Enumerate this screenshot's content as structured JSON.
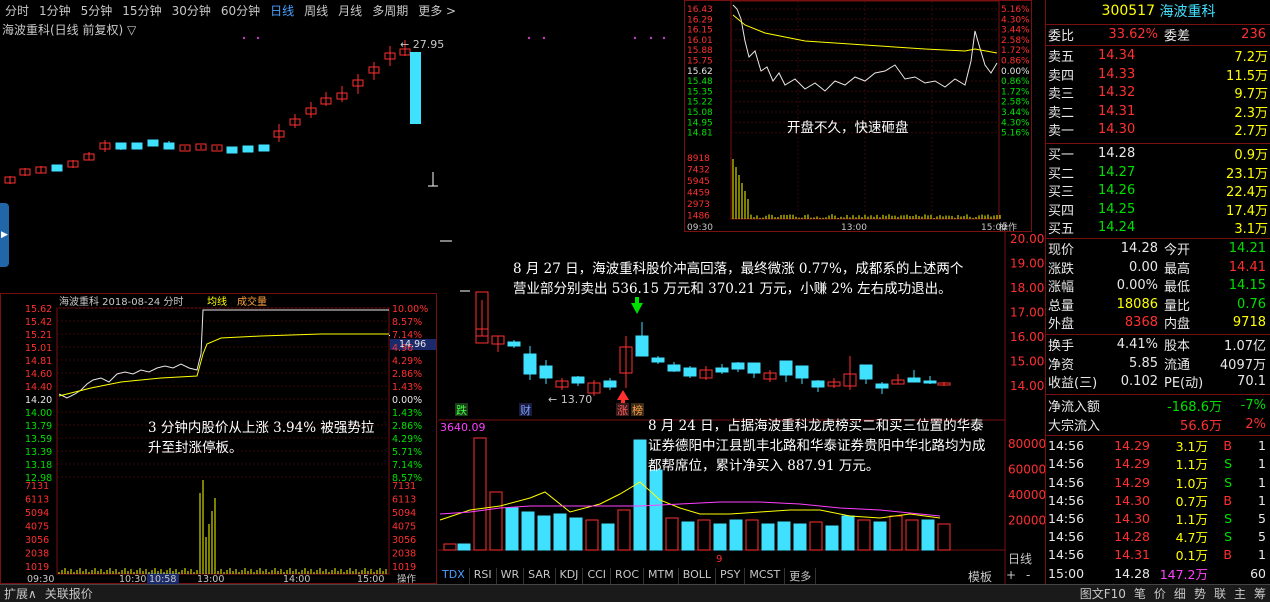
{
  "tabs": [
    "分时",
    "1分钟",
    "5分钟",
    "15分钟",
    "30分钟",
    "60分钟",
    "日线",
    "周线",
    "月线",
    "多周期",
    "更多 >"
  ],
  "active_tab": "日线",
  "kline_title": "海波重科(日线 前复权) ▽",
  "high_label": "← 27.95",
  "low_label": "← 13.70",
  "daily_axis": [
    "20.00",
    "19.00",
    "18.00",
    "17.00",
    "16.00",
    "15.00",
    "14.00"
  ],
  "vol_axis": [
    "80000",
    "60000",
    "40000",
    "20000"
  ],
  "macd_label": "3640.09",
  "period_label": "日线",
  "markers": {
    "die": "跌",
    "cai": "财",
    "zhang": "涨",
    "bang": "榜"
  },
  "indicator_tabs": [
    "TDX",
    "RSI",
    "WR",
    "SAR",
    "KDJ",
    "CCI",
    "ROC",
    "MTM",
    "BOLL",
    "PSY",
    "MCST",
    "更多"
  ],
  "template": "模板",
  "zoom": [
    "+",
    "-"
  ],
  "bottom": {
    "left": [
      "扩展∧",
      "关联报价"
    ],
    "right": [
      "图文F10",
      "笔",
      "价",
      "细",
      "势",
      "联",
      "主",
      "筹"
    ]
  },
  "annotations": {
    "a1": "开盘不久，快速砸盘",
    "a2": "8 月 27 日，海波重科股价冲高回落，最终微涨 0.77%，成都系的上述两个营业部分别卖出 536.15 万元和 370.21 万元，小赚 2% 左右成功退出。",
    "a3": "3 分钟内股价从上涨 3.94% 被强势拉升至封涨停板。",
    "a4": "8 月 24 日，占据海波重科龙虎榜买二和买三位置的华泰证券德阳中江县凯丰北路和华泰证券贵阳中华北路均为成都帮席位，累计净买入 887.91 万元。"
  },
  "intraday_0827": {
    "left_axis": [
      "16.43",
      "16.29",
      "16.15",
      "16.01",
      "15.88",
      "15.75",
      "15.62",
      "15.48",
      "15.35",
      "15.22",
      "15.08",
      "14.95",
      "14.81"
    ],
    "right_axis": [
      "5.16%",
      "4.30%",
      "3.44%",
      "2.58%",
      "1.72%",
      "0.86%",
      "0.00%",
      "0.86%",
      "1.72%",
      "2.58%",
      "3.44%",
      "4.30%",
      "5.16%"
    ],
    "vol_axis": [
      "8918",
      "7432",
      "5945",
      "4459",
      "2973",
      "1486"
    ],
    "times": [
      "09:30",
      "13:00",
      "15:00"
    ],
    "op": "操作"
  },
  "intraday_0824": {
    "title": "海波重科  2018-08-24 分时",
    "legend": [
      "均线",
      "成交量"
    ],
    "left_axis": [
      "15.62",
      "15.42",
      "15.21",
      "15.01",
      "14.81",
      "14.60",
      "14.40",
      "14.20",
      "14.00",
      "13.79",
      "13.59",
      "13.39",
      "13.18",
      "12.98"
    ],
    "right_axis": [
      "10.00%",
      "8.57%",
      "7.14%",
      "4.96",
      "4.29%",
      "2.86%",
      "1.43%",
      "0.00%",
      "1.43%",
      "2.86%",
      "4.29%",
      "5.71%",
      "7.14%",
      "8.57%"
    ],
    "cur_price": "14.96",
    "vol_axis": [
      "7131",
      "6113",
      "5094",
      "4075",
      "3056",
      "2038",
      "1019"
    ],
    "times": [
      "09:30",
      "10:30",
      "10:58",
      "13:00",
      "14:00",
      "15:00"
    ],
    "op": "操作"
  },
  "quote": {
    "code": "300517",
    "name": "海波重科",
    "weibi": [
      "委比",
      "33.62%",
      "委差",
      "236"
    ],
    "sell": [
      [
        "卖五",
        "14.34",
        "7.2万"
      ],
      [
        "卖四",
        "14.33",
        "11.5万"
      ],
      [
        "卖三",
        "14.32",
        "9.7万"
      ],
      [
        "卖二",
        "14.31",
        "2.3万"
      ],
      [
        "卖一",
        "14.30",
        "2.7万"
      ]
    ],
    "buy": [
      [
        "买一",
        "14.28",
        "0.9万"
      ],
      [
        "买二",
        "14.27",
        "23.1万"
      ],
      [
        "买三",
        "14.26",
        "22.4万"
      ],
      [
        "买四",
        "14.25",
        "17.4万"
      ],
      [
        "买五",
        "14.24",
        "3.1万"
      ]
    ],
    "stats": [
      [
        "现价",
        "14.28",
        "今开",
        "14.21"
      ],
      [
        "涨跌",
        "0.00",
        "最高",
        "14.41"
      ],
      [
        "涨幅",
        "0.00%",
        "最低",
        "14.15"
      ],
      [
        "总量",
        "18086",
        "量比",
        "0.76"
      ],
      [
        "外盘",
        "8368",
        "内盘",
        "9718"
      ]
    ],
    "stats2": [
      [
        "换手",
        "4.41%",
        "股本",
        "1.07亿"
      ],
      [
        "净资",
        "5.85",
        "流通",
        "4097万"
      ],
      [
        "收益(三)",
        "0.102",
        "PE(动)",
        "70.1"
      ]
    ],
    "flow": [
      [
        "净流入额",
        "-168.6万",
        "-7%"
      ],
      [
        "大宗流入",
        "56.6万",
        "2%"
      ]
    ],
    "ticks": [
      [
        "14:56",
        "14.29",
        "3.1万",
        "B",
        "1"
      ],
      [
        "14:56",
        "14.29",
        "1.1万",
        "S",
        "1"
      ],
      [
        "14:56",
        "14.29",
        "1.0万",
        "S",
        "1"
      ],
      [
        "14:56",
        "14.30",
        "0.7万",
        "B",
        "1"
      ],
      [
        "14:56",
        "14.30",
        "1.1万",
        "S",
        "5"
      ],
      [
        "14:56",
        "14.28",
        "4.7万",
        "S",
        "5"
      ],
      [
        "14:56",
        "14.31",
        "0.1万",
        "B",
        "1"
      ],
      [
        "15:00",
        "14.28",
        "147.2万",
        "",
        "60"
      ]
    ]
  }
}
